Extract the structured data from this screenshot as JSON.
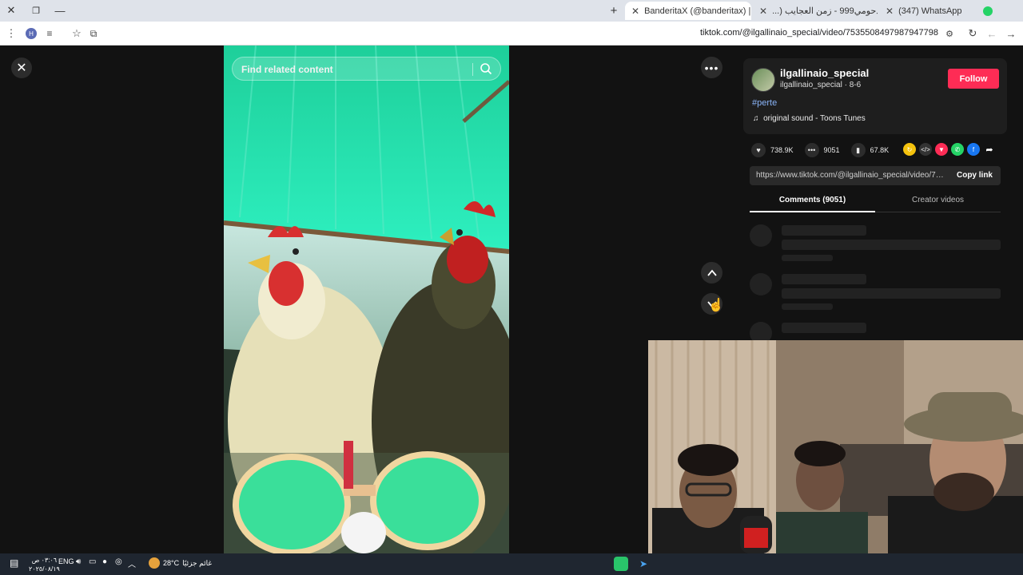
{
  "browser": {
    "tabs": [
      {
        "label": "(347) WhatsApp",
        "favicon_color": "#25d366"
      },
      {
        "label": "(1) دحومي999 - زمن العجايب (...",
        "favicon_color": "#ff0000"
      },
      {
        "label": "BanderitaX (@banderitax) | ...",
        "favicon_color": "#000000"
      }
    ],
    "address_url": "tiktok.com/@ilgallinaio_special/video/7535508497987947798",
    "profile_initial": "H",
    "window_controls": {
      "close": "✕",
      "restore": "❐",
      "minimize": "—"
    },
    "new_tab": "+"
  },
  "viewer": {
    "search_placeholder": "Find related content",
    "close_icon": "close-icon",
    "more_icon": "more-icon"
  },
  "creator": {
    "username": "ilgallinaio_special",
    "subline": "ilgallinaio_special · 8-6",
    "follow_label": "Follow",
    "hashtag": "#perte",
    "sound": "original sound - Toons Tunes"
  },
  "stats": {
    "likes": "738.9K",
    "comments": "9051",
    "saves": "67.8K"
  },
  "share": {
    "link": "https://www.tiktok.com/@ilgallinaio_special/video/753...",
    "copy_label": "Copy link",
    "icons": [
      {
        "name": "repost-icon",
        "color": "#f4c20d"
      },
      {
        "name": "embed-icon",
        "color": "#333333"
      },
      {
        "name": "send-icon",
        "color": "#fe2c55"
      },
      {
        "name": "whatsapp-icon",
        "color": "#25d366"
      },
      {
        "name": "facebook-icon",
        "color": "#1877f2"
      },
      {
        "name": "share-arrow-icon",
        "color": "#121212"
      }
    ]
  },
  "comment_tabs": {
    "comments": "Comments (9051)",
    "creator_videos": "Creator videos"
  },
  "taskbar": {
    "time": "٠٣:٠٦ ص",
    "date": "٢٠٢٥/٠٨/١٩",
    "lang": "ENG",
    "temp": "28°C",
    "weather_text": "غائم جزئيًا"
  }
}
